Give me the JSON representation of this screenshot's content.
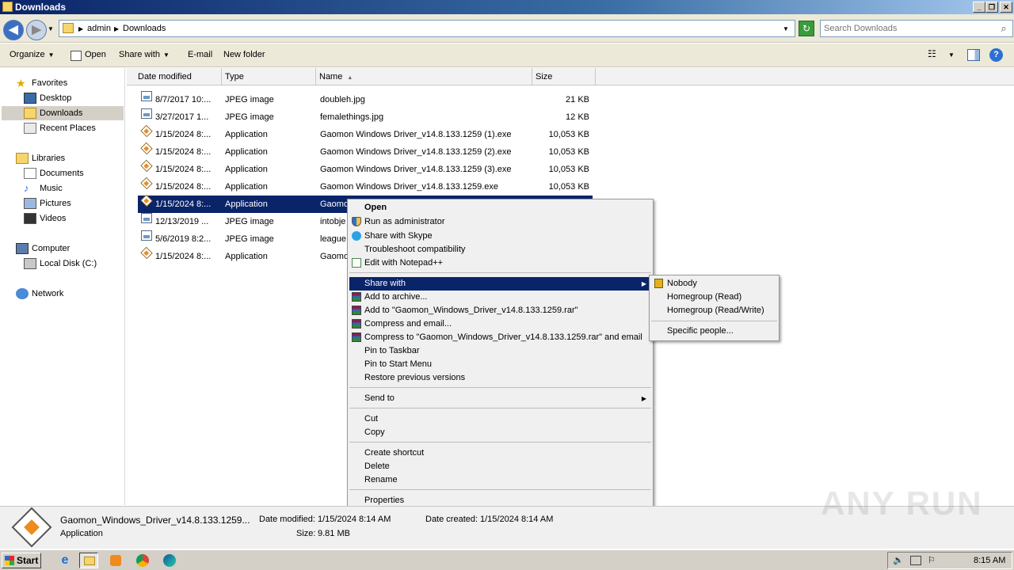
{
  "window": {
    "title": "Downloads"
  },
  "address": {
    "crumbs": [
      "admin",
      "Downloads"
    ],
    "search_placeholder": "Search Downloads"
  },
  "toolbar": {
    "organize": "Organize",
    "open": "Open",
    "share_with": "Share with",
    "email": "E-mail",
    "new_folder": "New folder"
  },
  "nav": {
    "favorites": "Favorites",
    "desktop": "Desktop",
    "downloads": "Downloads",
    "recent_places": "Recent Places",
    "libraries": "Libraries",
    "documents": "Documents",
    "music": "Music",
    "pictures": "Pictures",
    "videos": "Videos",
    "computer": "Computer",
    "local_disk": "Local Disk (C:)",
    "network": "Network"
  },
  "columns": {
    "date": "Date modified",
    "type": "Type",
    "name": "Name",
    "size": "Size"
  },
  "files": [
    {
      "date": "8/7/2017 10:...",
      "type": "JPEG image",
      "name": "doubleh.jpg",
      "size": "21 KB",
      "icon": "jpg-icon"
    },
    {
      "date": "3/27/2017 1...",
      "type": "JPEG image",
      "name": "femalethings.jpg",
      "size": "12 KB",
      "icon": "jpg-icon"
    },
    {
      "date": "1/15/2024 8:...",
      "type": "Application",
      "name": "Gaomon Windows Driver_v14.8.133.1259 (1).exe",
      "size": "10,053 KB",
      "icon": "exe-icon"
    },
    {
      "date": "1/15/2024 8:...",
      "type": "Application",
      "name": "Gaomon Windows Driver_v14.8.133.1259 (2).exe",
      "size": "10,053 KB",
      "icon": "exe-icon"
    },
    {
      "date": "1/15/2024 8:...",
      "type": "Application",
      "name": "Gaomon Windows Driver_v14.8.133.1259 (3).exe",
      "size": "10,053 KB",
      "icon": "exe-icon"
    },
    {
      "date": "1/15/2024 8:...",
      "type": "Application",
      "name": "Gaomon Windows Driver_v14.8.133.1259.exe",
      "size": "10,053 KB",
      "icon": "exe-icon"
    },
    {
      "date": "1/15/2024 8:...",
      "type": "Application",
      "name": "Gaomo",
      "size": "",
      "icon": "exe-icon"
    },
    {
      "date": "12/13/2019 ...",
      "type": "JPEG image",
      "name": "intobje",
      "size": "",
      "icon": "jpg-icon"
    },
    {
      "date": "5/6/2019 8:2...",
      "type": "JPEG image",
      "name": "league",
      "size": "",
      "icon": "jpg-icon"
    },
    {
      "date": "1/15/2024 8:...",
      "type": "Application",
      "name": "Gaomo",
      "size": "",
      "icon": "exe-icon"
    }
  ],
  "context_menu": {
    "open": "Open",
    "run_as_admin": "Run as administrator",
    "share_skype": "Share with Skype",
    "troubleshoot": "Troubleshoot compatibility",
    "edit_notepad": "Edit with Notepad++",
    "share_with": "Share with",
    "add_archive": "Add to archive...",
    "add_rar": "Add to \"Gaomon_Windows_Driver_v14.8.133.1259.rar\"",
    "compress_email": "Compress and email...",
    "compress_rar_email": "Compress to \"Gaomon_Windows_Driver_v14.8.133.1259.rar\" and email",
    "pin_taskbar": "Pin to Taskbar",
    "pin_start": "Pin to Start Menu",
    "restore_versions": "Restore previous versions",
    "send_to": "Send to",
    "cut": "Cut",
    "copy": "Copy",
    "create_shortcut": "Create shortcut",
    "delete": "Delete",
    "rename": "Rename",
    "properties": "Properties"
  },
  "submenu": {
    "nobody": "Nobody",
    "homegroup_read": "Homegroup (Read)",
    "homegroup_rw": "Homegroup (Read/Write)",
    "specific_people": "Specific people..."
  },
  "details": {
    "filename": "Gaomon_Windows_Driver_v14.8.133.1259...",
    "type": "Application",
    "modified_label": "Date modified:",
    "modified_value": "1/15/2024 8:14 AM",
    "created_label": "Date created:",
    "created_value": "1/15/2024 8:14 AM",
    "size_label": "Size:",
    "size_value": "9.81 MB"
  },
  "taskbar": {
    "start": "Start",
    "clock": "8:15 AM"
  },
  "watermark": "ANY RUN",
  "colors": {
    "selection": "#0a246a",
    "menu_bg": "#f0f0f0",
    "chrome": "#ece9d8"
  }
}
